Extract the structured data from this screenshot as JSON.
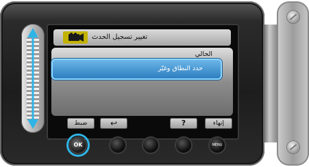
{
  "screen": {
    "title": "تغيير تسجيل الحدث",
    "current_label": "الحالي",
    "option_label": "حدد النطاق وغيّر"
  },
  "soft_buttons": {
    "set": "ضبط",
    "back": "↩",
    "help": "?",
    "end": "إنهاء"
  },
  "hardware": {
    "ok": "OK",
    "menu": "MENU"
  },
  "colors": {
    "highlight": "#2d7fc0",
    "ring": "#2fb4e6",
    "video_icon_bg": "#c2b200"
  }
}
